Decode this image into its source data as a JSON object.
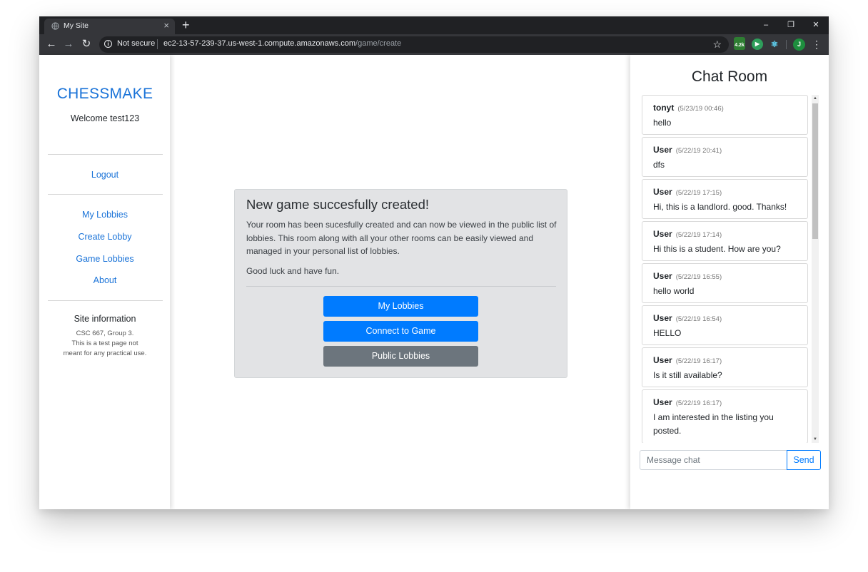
{
  "browser": {
    "tab_title": "My Site",
    "tab_close": "×",
    "new_tab": "+",
    "security_label": "Not secure",
    "url_host": "ec2-13-57-239-37.us-west-1.compute.amazonaws.com",
    "url_path": "/game/create",
    "extension_badge": "4.2k",
    "profile_initial": "J",
    "window_controls": {
      "minimize": "–",
      "restore": "❐",
      "close": "✕"
    }
  },
  "sidebar": {
    "brand": "CHESSMAKE",
    "welcome": "Welcome test123",
    "logout": "Logout",
    "nav": [
      "My Lobbies",
      "Create Lobby",
      "Game Lobbies",
      "About"
    ],
    "site_info_title": "Site information",
    "site_info_lines": [
      "CSC 667, Group 3.",
      "This is a test page not",
      "meant for any practical use."
    ]
  },
  "card": {
    "title": "New game succesfully created!",
    "body": "Your room has been sucesfully created and can now be viewed in the public list of lobbies. This room along with all your other rooms can be easily viewed and managed in your personal list of lobbies.",
    "footer": "Good luck and have fun.",
    "buttons": [
      "My Lobbies",
      "Connect to Game",
      "Public Lobbies"
    ]
  },
  "chat": {
    "title": "Chat Room",
    "messages": [
      {
        "user": "tonyt",
        "time": "(5/23/19 00:46)",
        "text": "hello"
      },
      {
        "user": "User",
        "time": "(5/22/19 20:41)",
        "text": "dfs"
      },
      {
        "user": "User",
        "time": "(5/22/19 17:15)",
        "text": "Hi, this is a landlord. good. Thanks!"
      },
      {
        "user": "User",
        "time": "(5/22/19 17:14)",
        "text": "Hi this is a student. How are you?"
      },
      {
        "user": "User",
        "time": "(5/22/19 16:55)",
        "text": "hello world"
      },
      {
        "user": "User",
        "time": "(5/22/19 16:54)",
        "text": "HELLO"
      },
      {
        "user": "User",
        "time": "(5/22/19 16:17)",
        "text": "Is it still available?"
      },
      {
        "user": "User",
        "time": "(5/22/19 16:17)",
        "text": "I am interested in the listing you posted."
      }
    ],
    "input_placeholder": "Message chat",
    "send": "Send"
  },
  "colors": {
    "link": "#1a73d8",
    "primary": "#007bff",
    "secondary": "#6c757d",
    "card_bg": "#e2e3e5"
  }
}
